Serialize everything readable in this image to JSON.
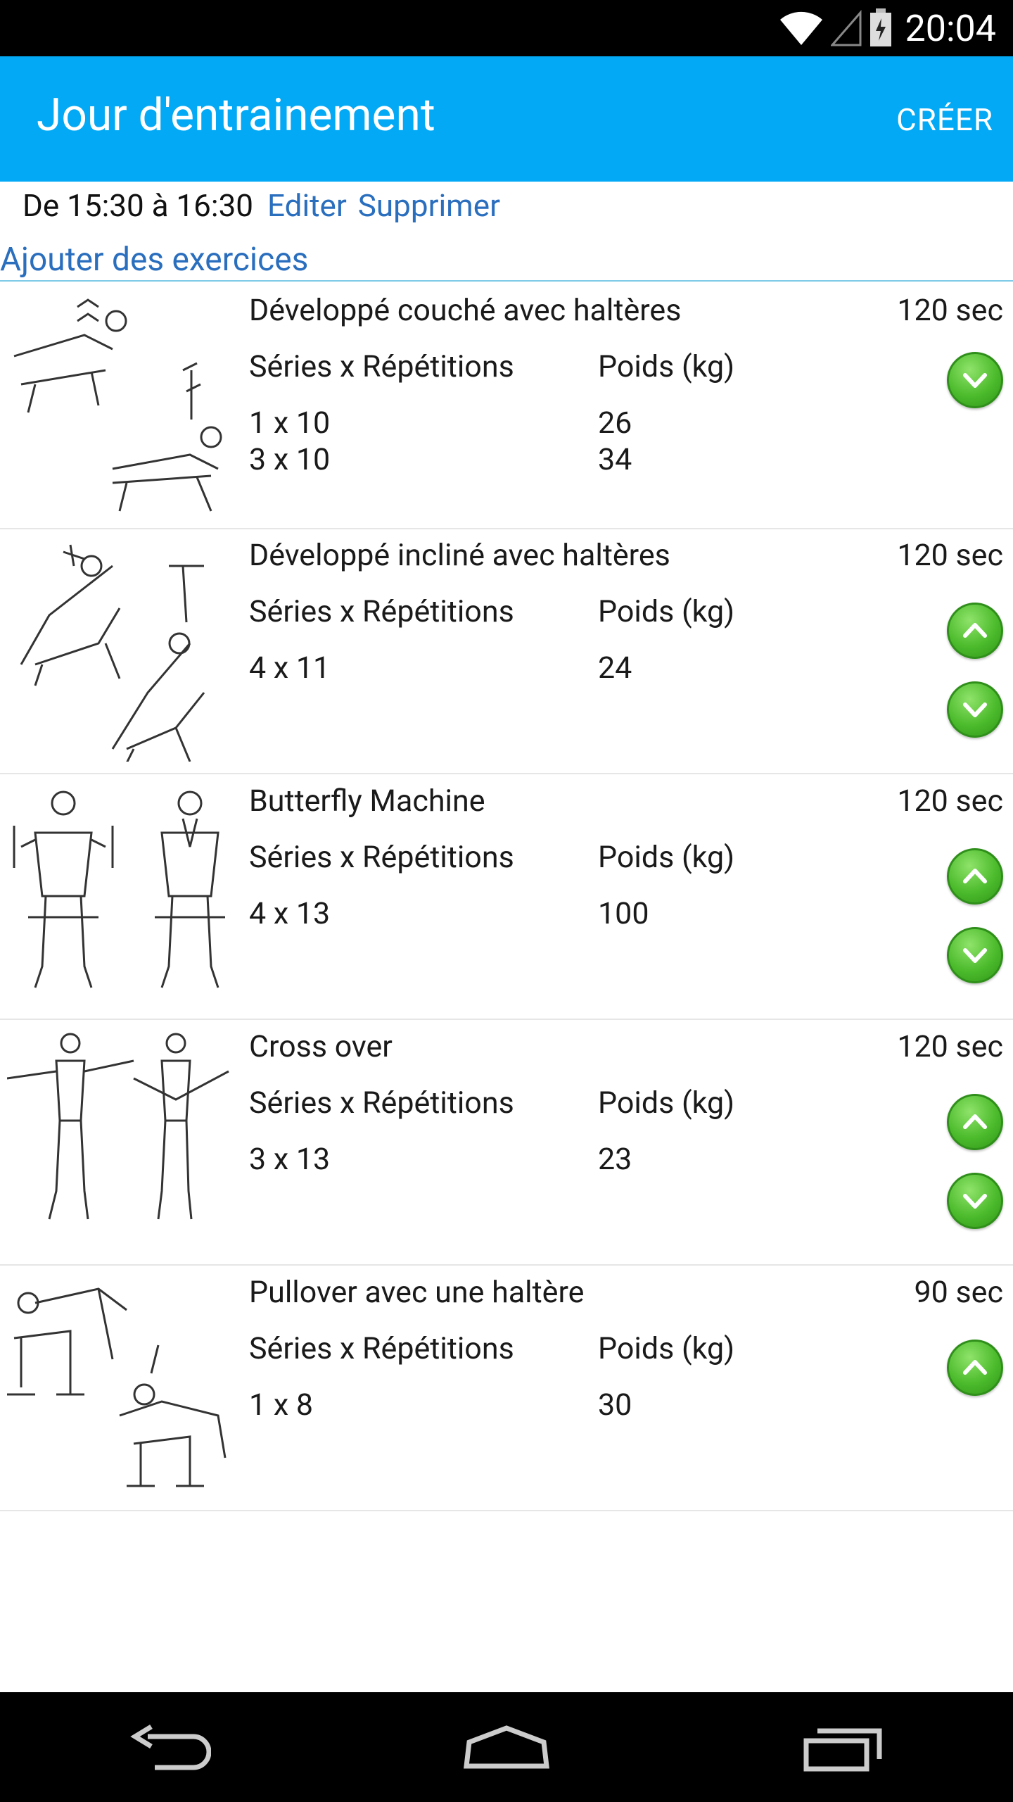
{
  "status_bar": {
    "time": "20:04",
    "icons": [
      "wifi-icon",
      "cell-signal-icon",
      "battery-icon"
    ]
  },
  "app_bar": {
    "title": "Jour d'entrainement",
    "action": "CRÉER",
    "color": "#03a9f4"
  },
  "schedule": {
    "text": "De 15:30 à 16:30",
    "edit": "Editer",
    "delete": "Supprimer"
  },
  "add_exercises": "Ajouter des exercices",
  "exercises": [
    {
      "name": "Développé couché avec haltères",
      "rest": "120 sec",
      "sets_header": "Séries x Répétitions",
      "weight_header": "Poids (kg)",
      "rows": [
        {
          "sets": "1 x 10",
          "weight": "26"
        },
        {
          "sets": "3 x 10",
          "weight": "34"
        }
      ],
      "buttons": [
        "check-down-icon"
      ]
    },
    {
      "name": "Développé incliné avec haltères",
      "rest": "120 sec",
      "sets_header": "Séries x Répétitions",
      "weight_header": "Poids (kg)",
      "rows": [
        {
          "sets": "4 x 11",
          "weight": "24"
        }
      ],
      "buttons": [
        "chevron-up-icon",
        "check-down-icon"
      ]
    },
    {
      "name": "Butterfly Machine",
      "rest": "120 sec",
      "sets_header": "Séries x Répétitions",
      "weight_header": "Poids (kg)",
      "rows": [
        {
          "sets": "4 x 13",
          "weight": "100"
        }
      ],
      "buttons": [
        "chevron-up-icon",
        "check-down-icon"
      ]
    },
    {
      "name": "Cross over",
      "rest": "120 sec",
      "sets_header": "Séries x Répétitions",
      "weight_header": "Poids (kg)",
      "rows": [
        {
          "sets": "3 x 13",
          "weight": "23"
        }
      ],
      "buttons": [
        "chevron-up-icon",
        "check-down-icon"
      ]
    },
    {
      "name": "Pullover avec une haltère",
      "rest": "90 sec",
      "sets_header": "Séries x Répétitions",
      "weight_header": "Poids (kg)",
      "rows": [
        {
          "sets": "1 x 8",
          "weight": "30"
        }
      ],
      "buttons": [
        "chevron-up-icon"
      ]
    }
  ],
  "nav_bar": {
    "icons": [
      "back-icon",
      "home-icon",
      "recents-icon"
    ]
  }
}
